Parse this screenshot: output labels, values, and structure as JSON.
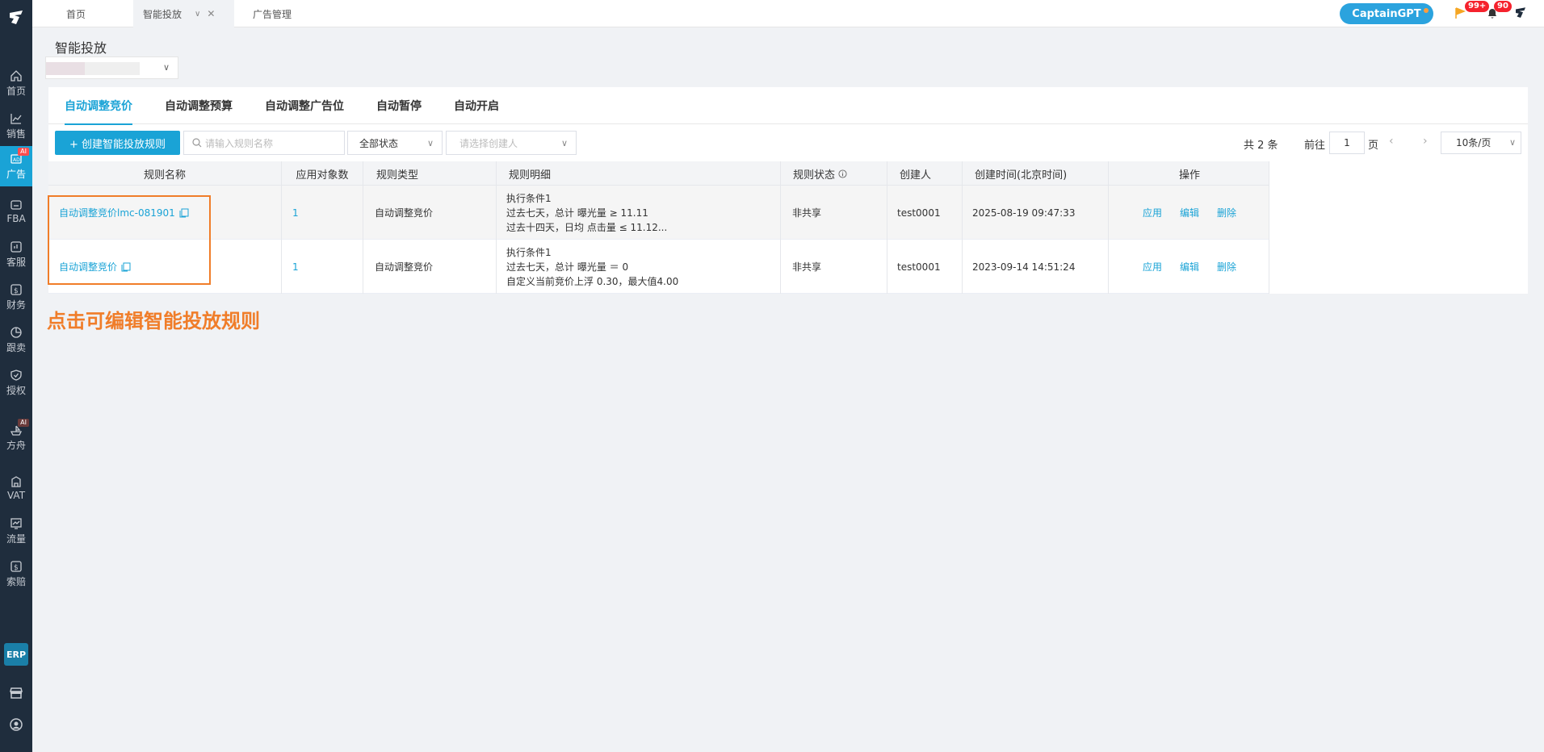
{
  "sidebar": {
    "items": [
      {
        "label": "首页",
        "icon": "home-icon"
      },
      {
        "label": "销售",
        "icon": "chart-icon"
      },
      {
        "label": "广告",
        "icon": "ad-icon",
        "badge": "AI",
        "active": true
      },
      {
        "label": "FBA",
        "icon": "fba-icon"
      },
      {
        "label": "客服",
        "icon": "service-icon"
      },
      {
        "label": "财务",
        "icon": "dollar-icon"
      },
      {
        "label": "跟卖",
        "icon": "pie-icon"
      },
      {
        "label": "授权",
        "icon": "shield-icon"
      },
      {
        "label": "方舟",
        "icon": "ark-icon",
        "badge": "AI"
      },
      {
        "label": "VAT",
        "icon": "building-icon"
      },
      {
        "label": "流量",
        "icon": "traffic-icon"
      },
      {
        "label": "索赔",
        "icon": "claim-icon"
      }
    ],
    "erp": "ERP"
  },
  "topbar": {
    "tabs": [
      "首页",
      "智能投放",
      "广告管理"
    ],
    "captain": "CaptainGPT",
    "flag_badge": "99+",
    "bell_badge": "90"
  },
  "page": {
    "title": "智能投放"
  },
  "subtabs": [
    "自动调整竞价",
    "自动调整预算",
    "自动调整广告位",
    "自动暂停",
    "自动开启"
  ],
  "toolbar": {
    "create_label": "+ 创建智能投放规则",
    "search_placeholder": "请输入规则名称",
    "status_value": "全部状态",
    "creator_placeholder": "请选择创建人"
  },
  "pager": {
    "total": "共 2 条",
    "goto": "前往",
    "page": "1",
    "page_unit": "页",
    "size": "10条/页"
  },
  "table": {
    "headers": [
      "规则名称",
      "应用对象数",
      "规则类型",
      "规则明细",
      "规则状态",
      "创建人",
      "创建时间(北京时间)",
      "操作"
    ],
    "rows": [
      {
        "name": "自动调整竞价lmc-081901",
        "count": "1",
        "type": "自动调整竞价",
        "detail": [
          "执行条件1",
          "过去七天，总计  曝光量 ≥ 11.11",
          "过去十四天，日均  点击量 ≤ 11.12..."
        ],
        "status": "非共享",
        "creator": "test0001",
        "created": "2025-08-19 09:47:33",
        "ops": [
          "应用",
          "编辑",
          "删除"
        ]
      },
      {
        "name": "自动调整竞价",
        "count": "1",
        "type": "自动调整竞价",
        "detail": [
          "执行条件1",
          "过去七天，总计  曝光量 ＝ 0",
          "自定义当前竞价上浮 0.30，最大值4.00"
        ],
        "status": "非共享",
        "creator": "test0001",
        "created": "2023-09-14 14:51:24",
        "ops": [
          "应用",
          "编辑",
          "删除"
        ]
      }
    ]
  },
  "annotation": "点击可编辑智能投放规则"
}
